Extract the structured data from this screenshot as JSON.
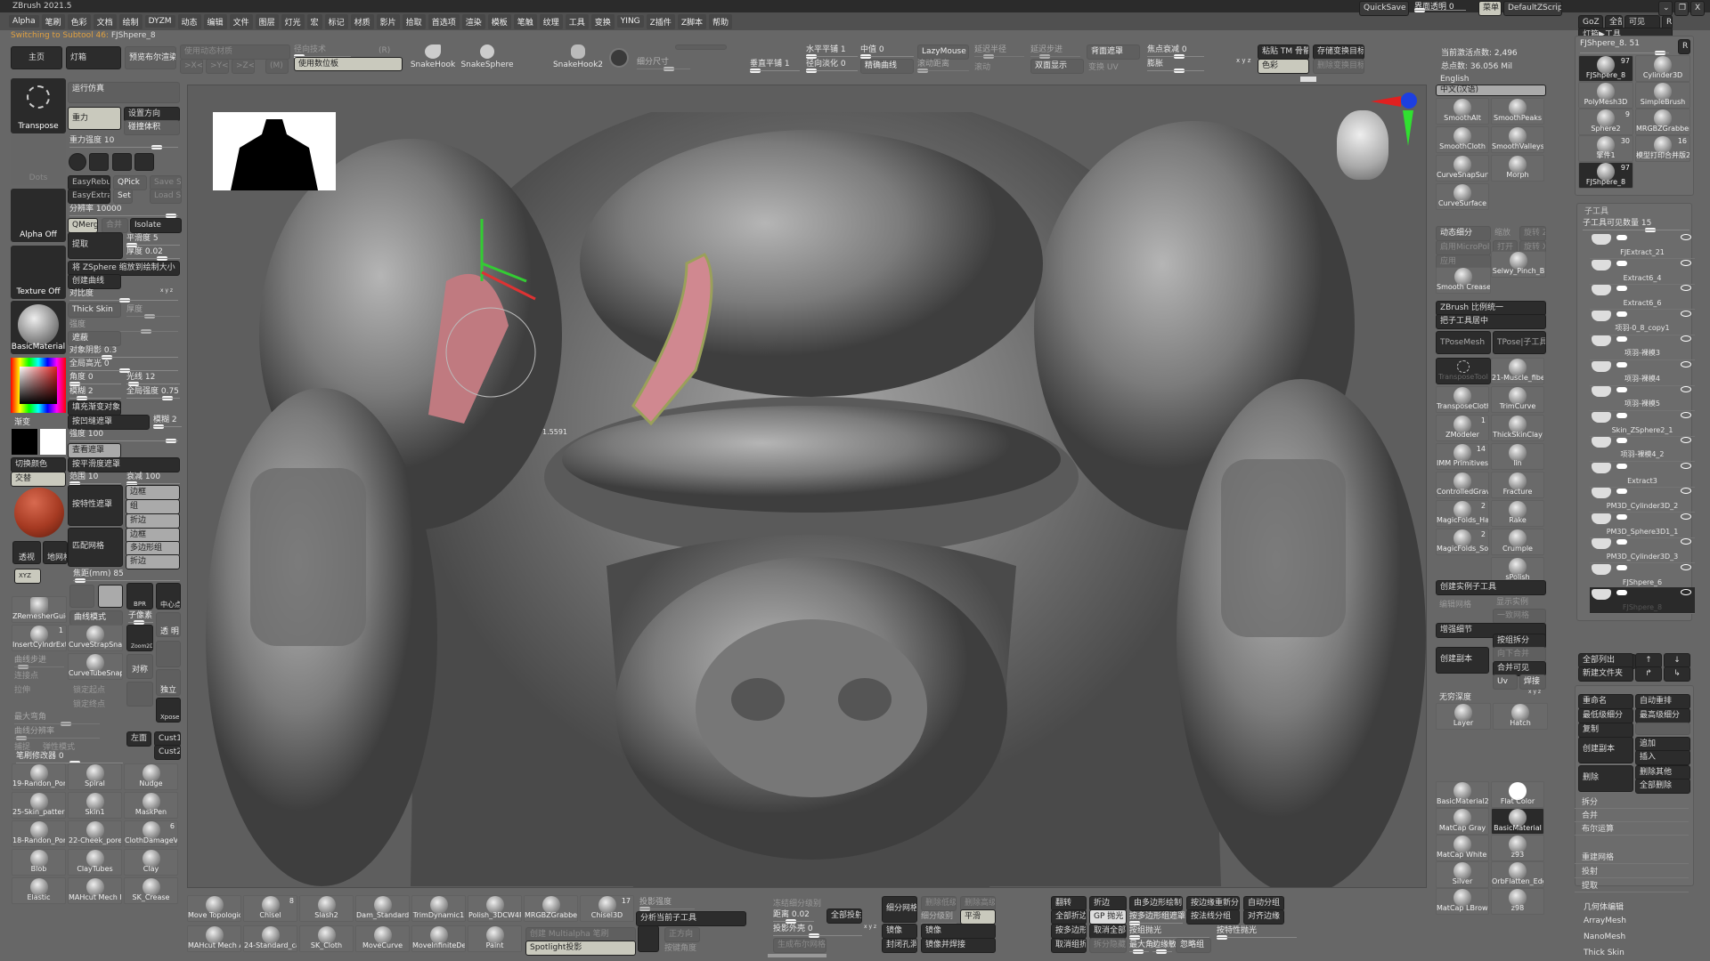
{
  "title": "ZBrush 2021.5",
  "menu": [
    "Alpha",
    "笔刷",
    "色彩",
    "文档",
    "绘制",
    "DYZM",
    "动态",
    "编辑",
    "文件",
    "图层",
    "灯光",
    "宏",
    "标记",
    "材质",
    "影片",
    "拾取",
    "首选项",
    "渲染",
    "模板",
    "笔触",
    "纹理",
    "工具",
    "变换",
    "YING",
    "Z插件",
    "Z脚本",
    "帮助"
  ],
  "status": {
    "prefix": "Switching to Subtool 46:",
    "name": "FJShpere_8"
  },
  "topright": {
    "quicksave": "QuickSave",
    "transparency": "界面透明 0",
    "menu": "菜单",
    "script": "DefaultZScript",
    "minimize": "⌄",
    "restore": "❐",
    "close": "X"
  },
  "shelf": {
    "home": "主页",
    "lightbox": "灯箱",
    "preview_bool": "预览布尔渲染",
    "use_dynamic": "使用动态材质",
    "radial": "径向技术",
    "r": "(R)",
    "x": ">X<",
    "y": ">Y<",
    "z": ">Z<",
    "m": "(M)",
    "use_tablet": "使用数位板",
    "snakehook": "SnakeHook",
    "snakesphere": "SnakeSphere",
    "snakehook2": "SnakeHook2",
    "subdiv_size": "细分尺寸",
    "htile": "水平平铺 1",
    "vtile": "垂直平铺 1",
    "radial_fade": "径向淡化 0",
    "median": "中值 0",
    "precise_curve": "精确曲线",
    "lazymouse": "LazyMouse",
    "lazy_radius": "延迟半径",
    "lazy_step": "延迟步进",
    "roll_dist": "滚动距离",
    "roll": "滚动",
    "backface": "背面遮罩",
    "double": "双面显示",
    "swap_uv": "变换 UV",
    "focal_falloff": "焦点衰减 0",
    "inflate": "膨胀",
    "xyz": "x y z",
    "paste_tm": "粘贴 TM 骨骼",
    "store_target": "存储变换目标",
    "color": "色彩",
    "del_target": "删除变换目标",
    "active_points": "当前激活点数: 2,496",
    "total_points": "总点数: 36.056 Mil"
  },
  "language": {
    "english": "English",
    "chinese": "中文(汉语)"
  },
  "left": {
    "transpose": "Transpose",
    "dots": "Dots",
    "alpha": "Alpha Off",
    "texture": "Texture Off",
    "material": "BasicMaterial",
    "gradient": "渐变",
    "switch_color": "切换颜色",
    "alternate": "交替",
    "perspective": "透视",
    "floor": "地网格",
    "xyz": "XYZ",
    "run_sim": "运行仿真",
    "gravity": "重力",
    "set_dir": "设置方向",
    "collision": "碰撞体积",
    "gravity_strength": "重力强度 10",
    "easyrebuild": "EasyRebuild",
    "qpick": "QPick",
    "saveset": "Save Set",
    "easyextract": "EasyExtract",
    "set1": "Set 1",
    "loadset": "Load Set",
    "resolution": "分辨率 10000",
    "qmerge": "QMerge",
    "merge": "合并",
    "isolate": "Isolate",
    "extract": "提取",
    "smooth": "平滑度 5",
    "thickness": "厚度 0.02",
    "zsphere_scale": "将 ZSphere 缩放到绘制大小",
    "create_curve": "创建曲线",
    "contrast": "对比度",
    "xyz_small": "x y z",
    "thickskin": "Thick Skin",
    "thick2": "厚度",
    "strength": "强度",
    "occlusion": "遮蔽",
    "obj_shadow": "对象阴影 0.3",
    "global_spec": "全局高光 0",
    "angle": "角度 0",
    "rays": "光线 12",
    "blur": "模糊 2",
    "global_strength": "全局强度 0.75",
    "fill_gradient": "填充渐变对象",
    "cavity_mask": "按凹缝遮罩",
    "blur2": "模糊 2",
    "strength100": "强度 100",
    "view_mask": "查看遮罩",
    "smooth_mask": "按平滑度遮罩",
    "range": "范围 10",
    "falloff": "衰减 100",
    "feature_mask": "按特性遮罩",
    "border": "边框",
    "group": "组",
    "crease": "折边",
    "match_mesh": "匹配网格",
    "border2": "边框",
    "polygroup": "多边形组",
    "crease2": "折边",
    "focal": "焦距(mm) 85",
    "zremesher": "ZRemesherGuic",
    "curve_mode": "曲线模式",
    "subpixel": "子像素",
    "bpr": "BPR",
    "center": "中心点",
    "transp": "透 明",
    "insertcyl": "InsertCylndrExt",
    "insertcyl_count": "1",
    "strapsnap": "CurveStrapSnap",
    "tubesnap": "CurveTubeSnap",
    "curve_step": "曲线步进",
    "connect": "连接点",
    "stretch": "拉伸",
    "lock_start": "锁定起点",
    "lock_end": "锁定终点",
    "max_bend": "最大弯角",
    "curve_res": "曲线分辨率",
    "snap": "捕捉",
    "elastic_mode": "弹性模式",
    "zoom2d": "Zoom2D",
    "symmetry": "对称",
    "solo": "独立",
    "xpose": "Xpose",
    "leftview": "左面",
    "cust1": "Cust1",
    "cust2": "Cust2",
    "brush_mod": "笔刷修改器 0"
  },
  "left_brushes": [
    {
      "label": "19-Randon_Por"
    },
    {
      "label": "Spiral"
    },
    {
      "label": "Nudge"
    },
    {
      "label": "25-Skin_pattern"
    },
    {
      "label": "Skin1"
    },
    {
      "label": "MaskPen"
    },
    {
      "label": "18-Randon_Por"
    },
    {
      "label": "22-Cheek_pores"
    },
    {
      "label": "ClothDamageVD",
      "count": "6"
    },
    {
      "label": "Blob"
    },
    {
      "label": "ClayTubes"
    },
    {
      "label": "Clay"
    },
    {
      "label": "Elastic"
    },
    {
      "label": "MAHcut Mech B"
    },
    {
      "label": "SK_Crease"
    }
  ],
  "bottom_brushes": [
    {
      "label": "Move Topologic"
    },
    {
      "label": "Chisel",
      "count": "8"
    },
    {
      "label": "Slash2"
    },
    {
      "label": "Dam_Standard_"
    },
    {
      "label": "TrimDynamic1"
    },
    {
      "label": "Polish_3DCW4R"
    },
    {
      "label": "MRGBZGrabber"
    },
    {
      "label": "Chisel3D",
      "count": "17"
    },
    {
      "label": "MAHcut Mech A"
    },
    {
      "label": "24-Standard_ca"
    },
    {
      "label": "SK_Cloth"
    },
    {
      "label": "MoveCurve"
    },
    {
      "label": "MoveInfiniteDep"
    },
    {
      "label": "Paint"
    }
  ],
  "bottom": {
    "proj_strength": "投影强度",
    "analyze": "分析当前子工具",
    "multialpha": "创建 Multialpha 笔刷",
    "spotlight": "Spotlight投影",
    "opposite": "正方向",
    "proj_angle": "按键角度",
    "freeze": "冻结细分级别",
    "distance": "距离 0.02",
    "project_all": "全部投射",
    "proj_shell": "投影外壳 0",
    "xyz": "x y z",
    "gen_bool": "生成布尔网格",
    "divide": "细分网格",
    "del_lower": "删除低级",
    "del_higher": "删除高级",
    "subdiv_level": "细分级别",
    "smooth": "平滑",
    "mirror": "镜像",
    "mirror2": "镜像",
    "mirror_weld": "镜像并焊接",
    "close_holes": "封闭孔洞",
    "flip": "翻转",
    "all_crease": "全部折边",
    "crease_pg": "按多边形组折边",
    "uncrease_grp": "取消组折边",
    "crease": "折边",
    "gp_polish": "GP 抛光",
    "uncrease_all": "取消全部折边",
    "split_hidden": "拆分隐藏",
    "polypaint_group": "由多边形绘制创建组",
    "pg_mask": "按多边形组遮罩 0",
    "group_polish": "按组抛光",
    "max_angle": "最大角!",
    "edge_sens": "边缘敏!",
    "ignore_grp": "忽略组",
    "regroup_edge": "按边缘重新分组",
    "normal_group": "按法线分组",
    "feature_polish": "按特性抛光",
    "auto_group": "自动分组",
    "align_edge": "对齐边缘"
  },
  "right_brushes": [
    {
      "label": "SmoothAlt"
    },
    {
      "label": "SmoothPeaks"
    },
    {
      "label": "SmoothCloth"
    },
    {
      "label": "SmoothValleys"
    },
    {
      "label": "CurveSnapSurf."
    },
    {
      "label": "Morph"
    },
    {
      "label": "CurveSurface"
    }
  ],
  "right": {
    "dyn_subdiv": "动态细分",
    "shrink": "缩放",
    "rot_z": "旋转 Z",
    "micropoly": "启用MicroPoly",
    "open": "打开",
    "rot_x": "旋转 X",
    "apply": "应用",
    "selwy": "Selwy_Pinch_B",
    "smooth_crease": "Smooth Crease",
    "unify": "ZBrush 比例统一",
    "center_sub": "把子工具居中",
    "tposemesh": "TPoseMesh",
    "tpose_sub": "TPose|子工具",
    "transpose_tool": "TransposeTool",
    "create_instance": "创建实例子工具",
    "edit_mesh": "编辑网格",
    "show_instance": "显示实例",
    "same_mesh": "一致网格",
    "enhance": "增强细节",
    "group_split": "按组拆分",
    "create_copy": "创建副本",
    "merge_down": "向下合并",
    "merge_visible": "合并可见",
    "uv": "Uv",
    "weld": "焊接",
    "inf_depth": "无穷深度",
    "xyz": "x y z",
    "layer": "Layer",
    "hatch": "Hatch"
  },
  "right_tools": [
    {
      "label": "21-Muscle_fiber"
    },
    {
      "label": "TransposeCloth"
    },
    {
      "label": "TrimCurve"
    },
    {
      "label": "ZModeler",
      "count": "1"
    },
    {
      "label": "ThickSkinClay"
    },
    {
      "label": "IMM Primitives",
      "count": "14"
    },
    {
      "label": "lin"
    },
    {
      "label": "ControlledGravit"
    },
    {
      "label": "Fracture"
    },
    {
      "label": "MagicFolds_Har",
      "count": "2"
    },
    {
      "label": "Rake"
    },
    {
      "label": "MagicFolds_Sof",
      "count": "2"
    },
    {
      "label": "Crumple"
    },
    {
      "label": ""
    },
    {
      "label": "sPolish"
    }
  ],
  "materials": [
    {
      "label": "BasicMaterial2"
    },
    {
      "label": "Flat Color"
    },
    {
      "label": "MatCap Gray"
    },
    {
      "label": "BasicMaterial"
    },
    {
      "label": "MatCap White C"
    },
    {
      "label": "z93"
    },
    {
      "label": "Silver"
    },
    {
      "label": "OrbFlatten_Edg"
    },
    {
      "label": "MatCap LBrown"
    },
    {
      "label": "z98"
    }
  ],
  "tool": {
    "goz": "GoZ",
    "all": "全部",
    "visible": "可见",
    "r": "R",
    "lightbox_tool": "灯箱▶工具",
    "current": "FJShpere_8. 51",
    "items": [
      {
        "label": "FJShpere_8",
        "count": "97"
      },
      {
        "label": "Cylinder3D"
      },
      {
        "label": "PolyMesh3D"
      },
      {
        "label": "SimpleBrush"
      },
      {
        "label": "Sphere2",
        "count": "9"
      },
      {
        "label": "MRGBZGrabber"
      },
      {
        "label": "擎件1",
        "count": "30"
      },
      {
        "label": "模型打印合并版2",
        "count": "16"
      },
      {
        "label": "FJShpere_8",
        "count": "97"
      }
    ]
  },
  "subtool": {
    "header": "子工具",
    "visible_count": "子工具可见数量 15",
    "items": [
      "FJExtract_21",
      "Extract6_4",
      "Extract6_6",
      "项羽-0_8_copy1",
      "项羽-裸模3",
      "项羽-裸模4",
      "项羽-裸模5",
      "Skin_ZSphere2_1",
      "项羽-裸模4_2",
      "Extract3",
      "PM3D_Cylinder3D_2",
      "PM3D_Sphere3D1_1",
      "PM3D_Cylinder3D_3",
      "FJShpere_6",
      "FJShpere_8"
    ],
    "list_all": "全部列出",
    "new_folder": "新建文件夹",
    "rename": "重命名",
    "auto_reorder": "自动重排",
    "lowest": "最低级细分",
    "highest": "最高级细分",
    "copy": "复制",
    "duplicate": "创建副本",
    "append": "追加",
    "insert": "插入",
    "delete": "删除",
    "del_other": "删除其他",
    "del_all": "全部删除",
    "split": "拆分",
    "merge": "合并",
    "boolean": "布尔运算",
    "remesh": "重建网格",
    "project": "投射",
    "extract": "提取",
    "geometry": "几何体编辑",
    "arraymesh": "ArrayMesh",
    "nanomesh": "NanoMesh",
    "thickskin": "Thick Skin"
  },
  "viewport": {
    "measure": "1.5591"
  },
  "colors": {
    "accent": "#e0a040",
    "button": "#2c2c2c",
    "panel": "#6c6c6c",
    "viewport": "#5d5d5d"
  }
}
